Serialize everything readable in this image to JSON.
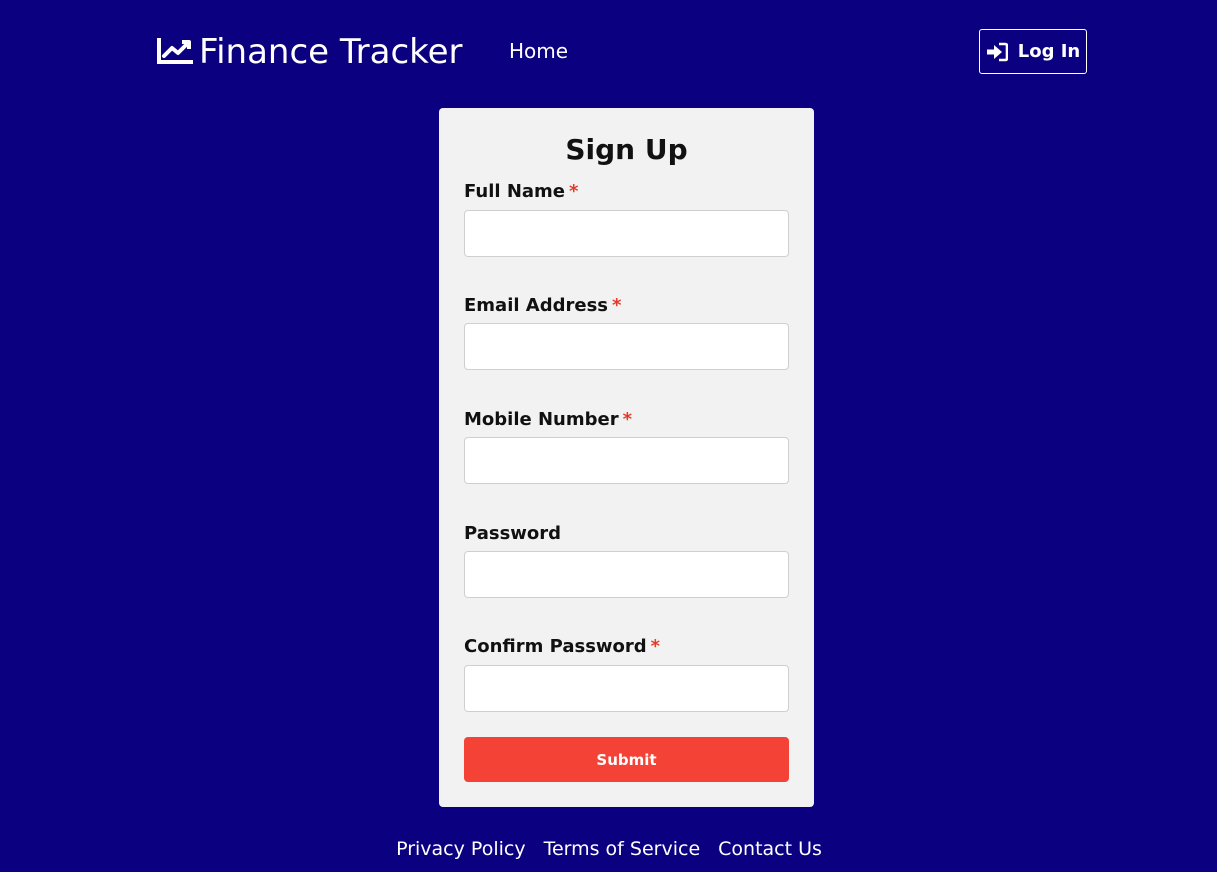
{
  "header": {
    "brand_name": "Finance Tracker",
    "brand_icon": "chart-line-icon",
    "nav_home": "Home",
    "login_label": "Log In",
    "login_icon": "sign-in-icon"
  },
  "form": {
    "title": "Sign Up",
    "required_marker": "*",
    "fields": [
      {
        "label": "Full Name",
        "required": true,
        "value": ""
      },
      {
        "label": "Email Address",
        "required": true,
        "value": ""
      },
      {
        "label": "Mobile Number",
        "required": true,
        "value": ""
      },
      {
        "label": "Password",
        "required": false,
        "value": ""
      },
      {
        "label": "Confirm Password",
        "required": true,
        "value": ""
      }
    ],
    "submit_label": "Submit"
  },
  "footer": {
    "links": [
      "Privacy Policy",
      "Terms of Service",
      "Contact Us"
    ]
  },
  "colors": {
    "background": "#0b0080",
    "card": "#f2f2f2",
    "accent": "#f44336",
    "required": "#e53a2a"
  }
}
